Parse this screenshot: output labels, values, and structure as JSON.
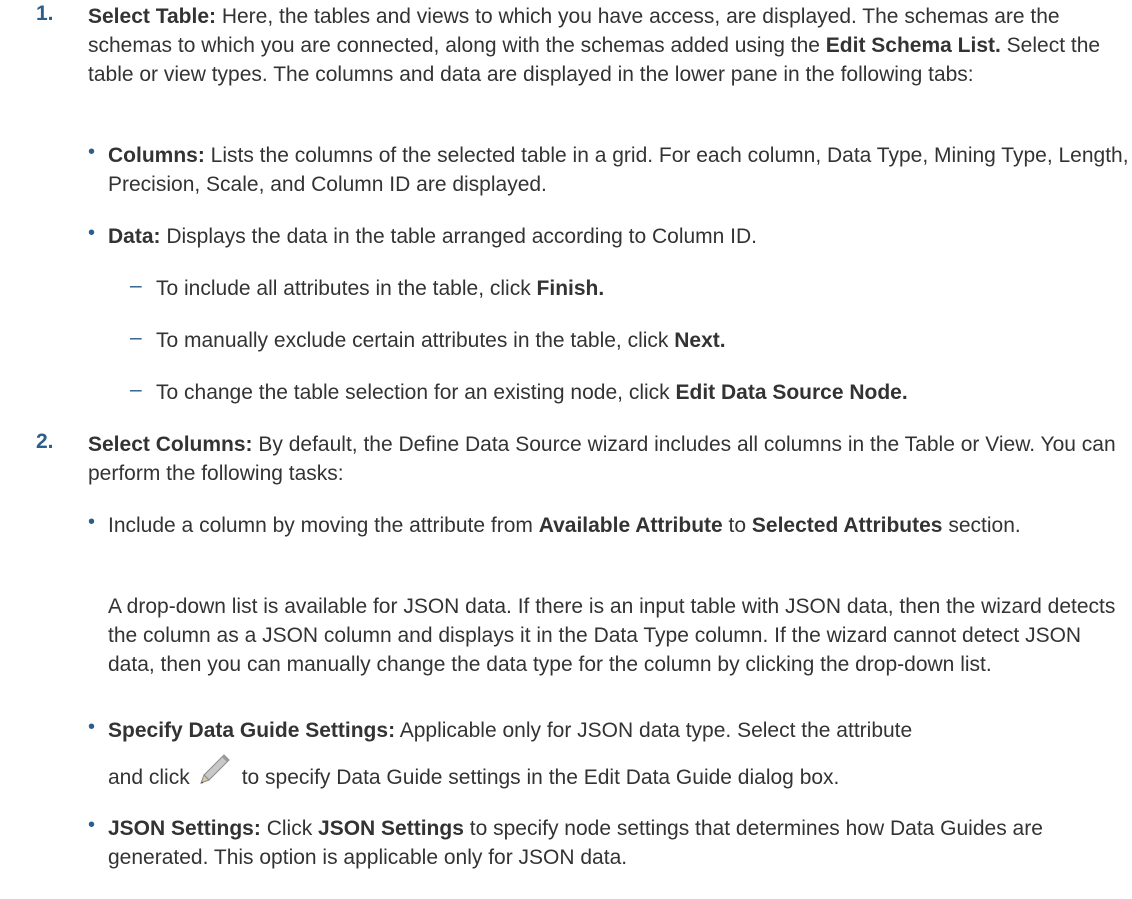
{
  "step1": {
    "number": "1.",
    "title": "Select Table:",
    "text_a": " Here, the tables and views to which you have access, are displayed. The schemas are the schemas to which you are connected, along with the schemas added using the ",
    "link": "Edit Schema List.",
    "text_b": " Select the table or view types. The columns and data are displayed in the lower pane in the following tabs:",
    "columns_bullet": {
      "title": "Columns:",
      "text": " Lists the columns of the selected table in a grid. For each column, Data Type, Mining Type, Length, Precision, Scale, and Column ID are displayed."
    },
    "data_bullet": {
      "title": "Data:",
      "text": " Displays the data in the table arranged according to Column ID."
    },
    "dash_items": [
      {
        "text": "To include all attributes in the table, click ",
        "bold": "Finish."
      },
      {
        "text": "To manually exclude certain attributes in the table, click ",
        "bold": "Next."
      },
      {
        "text": "To change the table selection for an existing node, click ",
        "bold": "Edit Data Source Node."
      }
    ]
  },
  "step2": {
    "number": "2.",
    "title": "Select Columns:",
    "text": " By default, the Define Data Source wizard includes all columns in the Table or View. You can perform the following tasks:",
    "include_bullet": {
      "text_a": "Include a column by moving the attribute from ",
      "bold_a": "Available Attribute",
      "text_b": " to ",
      "bold_b": "Selected Attributes",
      "text_c": " section.",
      "para": "A drop-down list is available for JSON data. If there is an input table with JSON data, then the wizard detects the column as a JSON column and displays it in the Data Type column. If the wizard cannot detect JSON data, then you can manually change the data type for the column by clicking the drop-down list."
    },
    "guide_bullet": {
      "title": "Specify Data Guide Settings:",
      "text_a": " Applicable only for JSON data type. Select the attribute",
      "text_b": "and click",
      "text_c": "to specify Data Guide settings in the Edit Data Guide dialog box."
    },
    "json_bullet": {
      "title": "JSON Settings:",
      "text_a": " Click ",
      "bold": "JSON Settings",
      "text_b": " to specify node settings that determines how Data Guides are generated. This option is applicable only for JSON data."
    }
  },
  "icons": {
    "edit": "pencil-icon"
  },
  "colors": {
    "accent": "#2c5e8c",
    "text": "#333333"
  }
}
